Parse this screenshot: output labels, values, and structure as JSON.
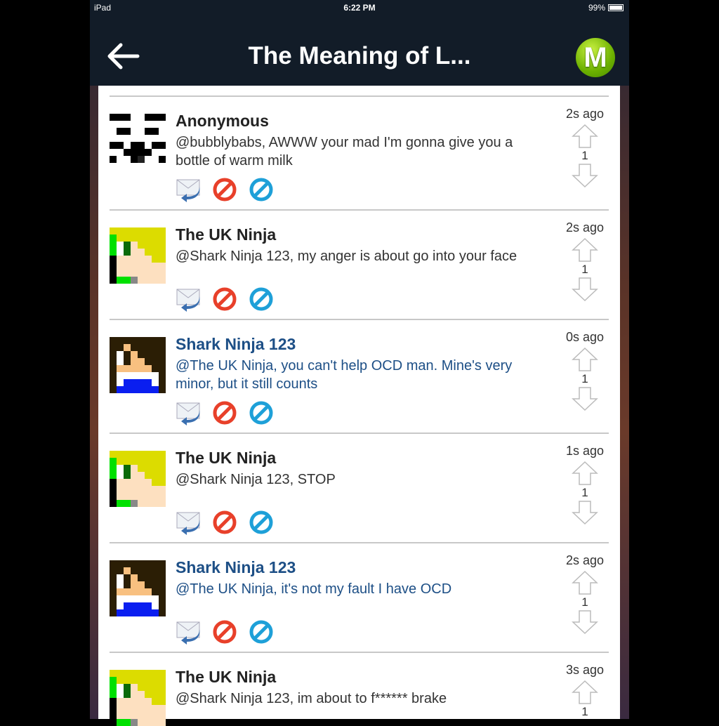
{
  "status": {
    "device": "iPad",
    "time": "6:22 PM",
    "battery": "99%"
  },
  "header": {
    "title": "The Meaning of L...",
    "logo_letter": "M"
  },
  "colors": {
    "nav": "#121c28",
    "highlight_user": "#1d4f86",
    "logo": "#6cb000"
  },
  "posts": [
    {
      "author": "Anonymous",
      "text": "@bubblybabs, AWWW your mad I'm gonna give you a bottle of warm milk",
      "time": "2s ago",
      "votes": "1",
      "avatar": "anon",
      "own": false
    },
    {
      "author": "The UK Ninja",
      "text": "@Shark Ninja 123, my anger is about go into your face",
      "time": "2s ago",
      "votes": "1",
      "avatar": "uk",
      "own": false
    },
    {
      "author": "Shark Ninja 123",
      "text": "@The UK Ninja, you can't help OCD man. Mine's very minor, but it still counts",
      "time": "0s ago",
      "votes": "1",
      "avatar": "shark",
      "own": true
    },
    {
      "author": "The UK Ninja",
      "text": "@Shark Ninja 123, STOP",
      "time": "1s ago",
      "votes": "1",
      "avatar": "uk",
      "own": false
    },
    {
      "author": "Shark Ninja 123",
      "text": "@The UK Ninja, it's not my fault I have OCD",
      "time": "2s ago",
      "votes": "1",
      "avatar": "shark",
      "own": true
    },
    {
      "author": "The UK Ninja",
      "text": "@Shark Ninja 123, im about to f****** brake",
      "time": "3s ago",
      "votes": "1",
      "avatar": "uk",
      "own": false
    }
  ]
}
